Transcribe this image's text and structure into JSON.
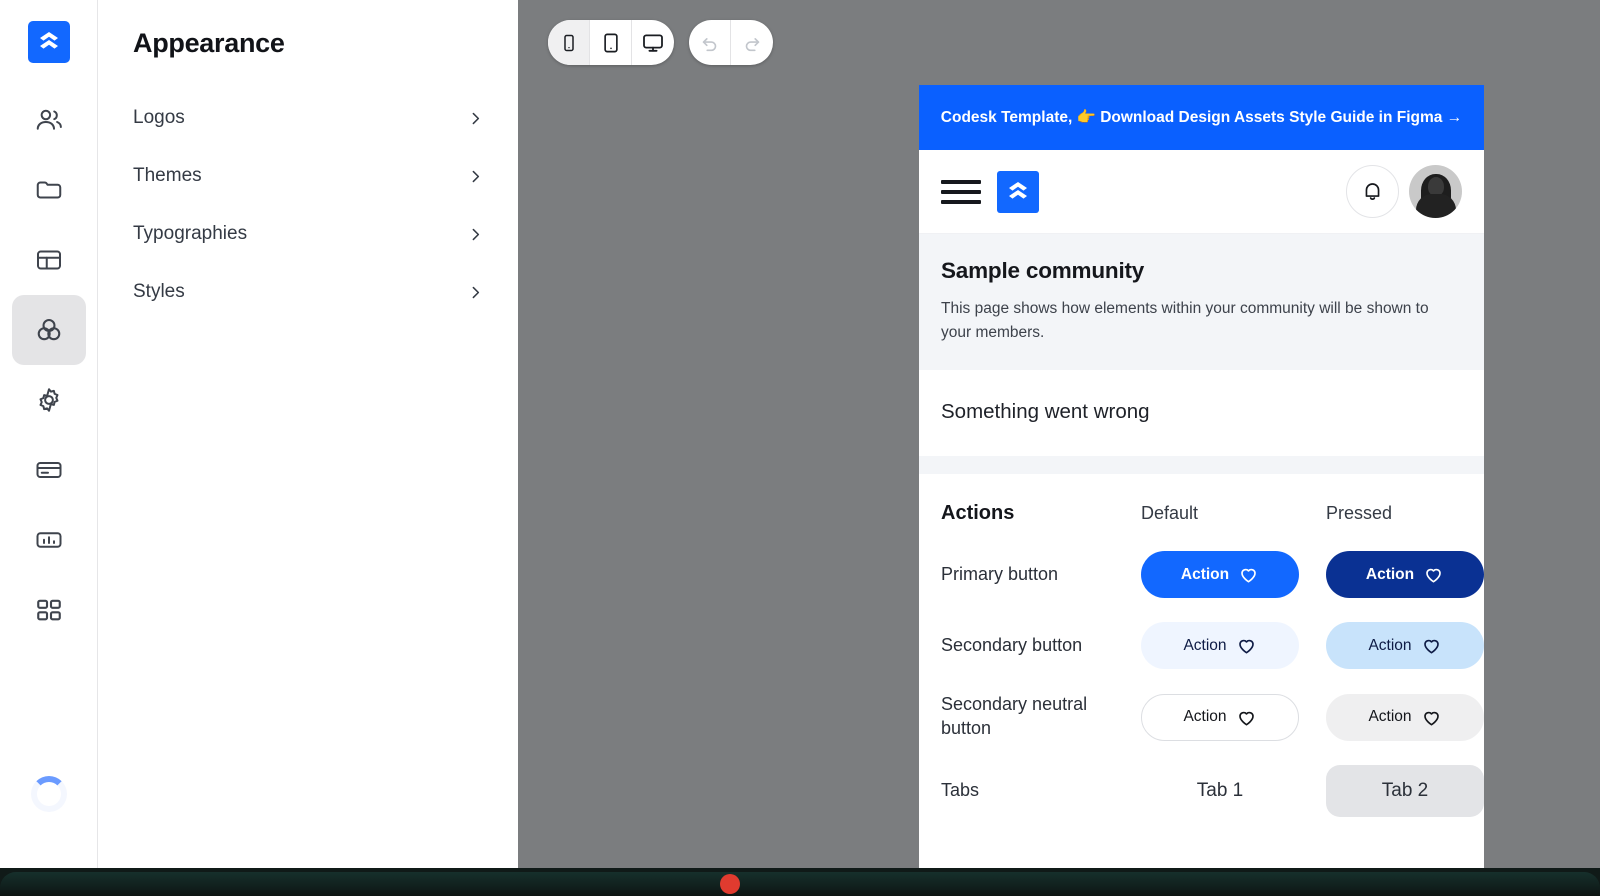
{
  "theme": {
    "brand_blue": "#1268ff",
    "banner_blue": "#0a60ff",
    "pressed_navy": "#0a3193",
    "canvas_gray": "#7b7d7f",
    "hero_bg": "#f3f5f8"
  },
  "rail": {
    "logo_name": "codesk-logo",
    "items": [
      {
        "name": "members-icon",
        "label": "Members"
      },
      {
        "name": "folder-icon",
        "label": "Content"
      },
      {
        "name": "layout-icon",
        "label": "Pages"
      },
      {
        "name": "appearance-icon",
        "label": "Appearance",
        "active": true
      },
      {
        "name": "gear-icon",
        "label": "Settings"
      },
      {
        "name": "card-icon",
        "label": "Billing"
      },
      {
        "name": "chart-icon",
        "label": "Analytics"
      },
      {
        "name": "grid-icon",
        "label": "Apps"
      }
    ],
    "spinner_label": "loading"
  },
  "panel": {
    "title": "Appearance",
    "rows": [
      {
        "label": "Logos"
      },
      {
        "label": "Themes"
      },
      {
        "label": "Typographies"
      },
      {
        "label": "Styles"
      }
    ]
  },
  "toolbar": {
    "devices": [
      {
        "name": "mobile-view-button",
        "label": "Mobile",
        "active": true
      },
      {
        "name": "tablet-view-button",
        "label": "Tablet",
        "active": false
      },
      {
        "name": "desktop-view-button",
        "label": "Desktop",
        "active": false
      }
    ],
    "history": [
      {
        "name": "undo-button",
        "label": "Undo"
      },
      {
        "name": "redo-button",
        "label": "Redo"
      }
    ]
  },
  "preview": {
    "banner": "Codesk Template, 👉 Download Design Assets Style Guide in Figma →",
    "hero": {
      "title": "Sample community",
      "description": "This page shows how elements within your community will be shown to your members."
    },
    "error": {
      "title": "Something went wrong"
    },
    "table": {
      "headers": {
        "col1": "Actions",
        "col2": "Default",
        "col3": "Pressed"
      },
      "rows": [
        {
          "label": "Primary button",
          "default_label": "Action",
          "pressed_label": "Action",
          "style": "primary"
        },
        {
          "label": "Secondary button",
          "default_label": "Action",
          "pressed_label": "Action",
          "style": "secondary"
        },
        {
          "label": "Secondary neutral button",
          "default_label": "Action",
          "pressed_label": "Action",
          "style": "neutral"
        }
      ],
      "tabs_row": {
        "label": "Tabs",
        "tab1": "Tab 1",
        "tab2": "Tab 2",
        "selected": "Tab 2"
      }
    }
  }
}
